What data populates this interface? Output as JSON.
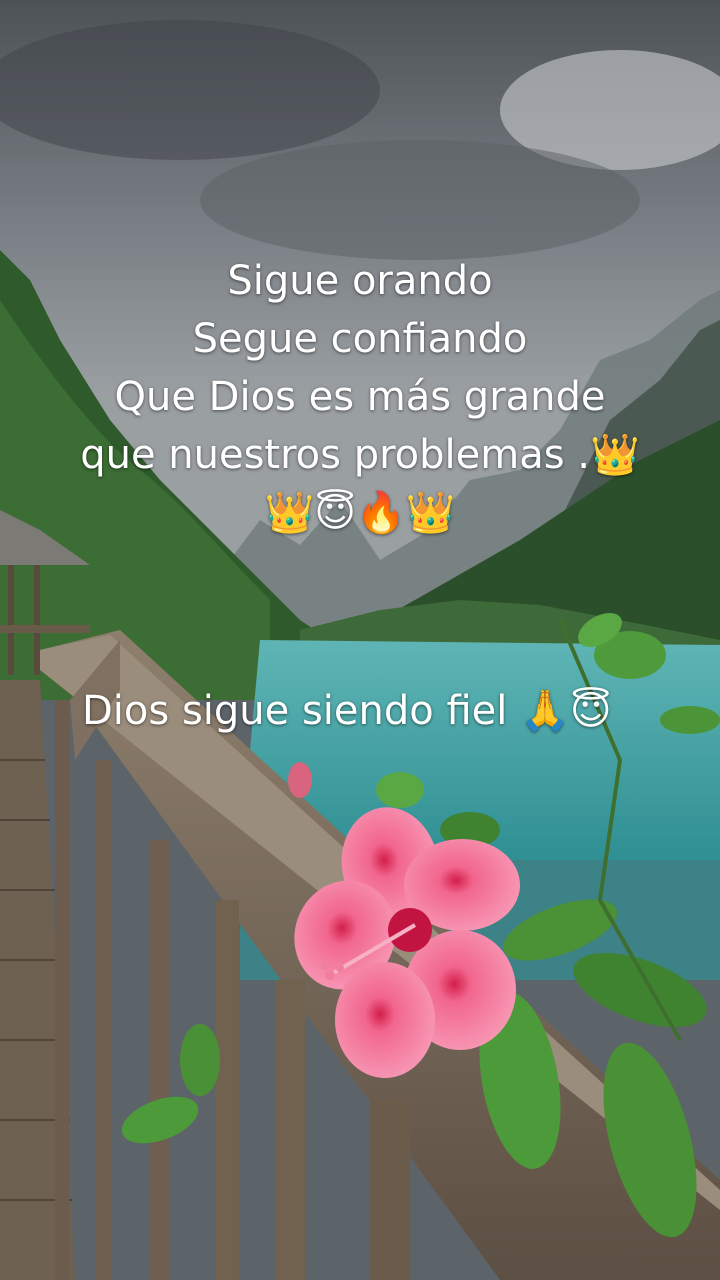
{
  "caption": {
    "lines": [
      "Sigue orando",
      "Segue confiando",
      "Que Dios es más grande",
      "que nuestros problemas .👑",
      "👑😇🔥👑"
    ],
    "subtitle": "Dios sigue siendo fiel 🙏😇"
  },
  "scene": {
    "elements": [
      "stormy-sky",
      "misty-mountains",
      "forested-hills",
      "turquoise-lake",
      "wooden-boardwalk",
      "wooden-railing",
      "gazebo",
      "pink-hibiscus-flower",
      "green-leaves"
    ],
    "colors": {
      "sky": "#6b7075",
      "lake": "#3fa3a5",
      "forest": "#2f5a2c",
      "wood": "#7a6a58",
      "flower": "#f27aa0"
    }
  }
}
